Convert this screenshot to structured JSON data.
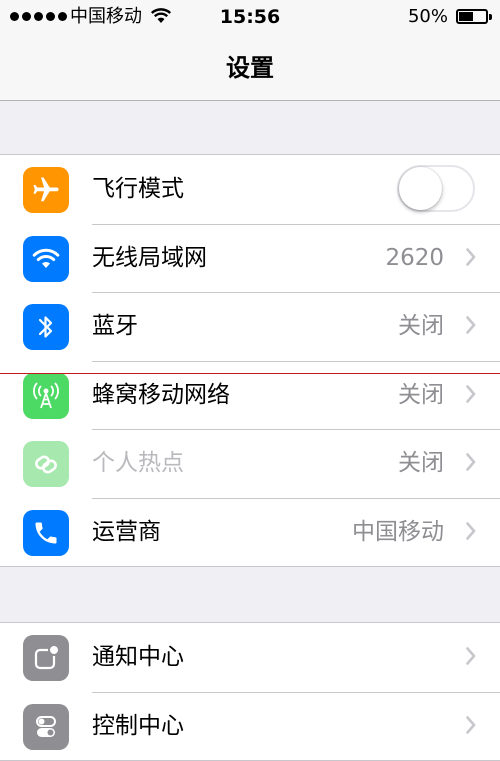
{
  "status_bar": {
    "carrier": "中国移动",
    "time": "15:56",
    "battery_percent": "50%",
    "battery_level": 0.5,
    "signal_dots": 5
  },
  "nav": {
    "title": "设置"
  },
  "colors": {
    "airplane": "#ff9500",
    "wifi": "#007aff",
    "bluetooth": "#007aff",
    "cellular": "#4cd964",
    "hotspot": "#a6e8ad",
    "carrier": "#007aff",
    "notification": "#8e8e93",
    "control": "#8e8e93",
    "chevron": "#c7c7cc"
  },
  "group1": {
    "items": [
      {
        "label": "飞行模式",
        "icon": "airplane-icon",
        "toggle_on": false
      },
      {
        "label": "无线局域网",
        "icon": "wifi-icon",
        "value": "2620"
      },
      {
        "label": "蓝牙",
        "icon": "bluetooth-icon",
        "value": "关闭"
      },
      {
        "label": "蜂窝移动网络",
        "icon": "cellular-antenna-icon",
        "value": "关闭"
      },
      {
        "label": "个人热点",
        "icon": "hotspot-link-icon",
        "value": "关闭"
      },
      {
        "label": "运营商",
        "icon": "phone-icon",
        "value": "中国移动"
      }
    ]
  },
  "group2": {
    "items": [
      {
        "label": "通知中心",
        "icon": "notification-center-icon"
      },
      {
        "label": "控制中心",
        "icon": "control-center-icon"
      }
    ]
  }
}
